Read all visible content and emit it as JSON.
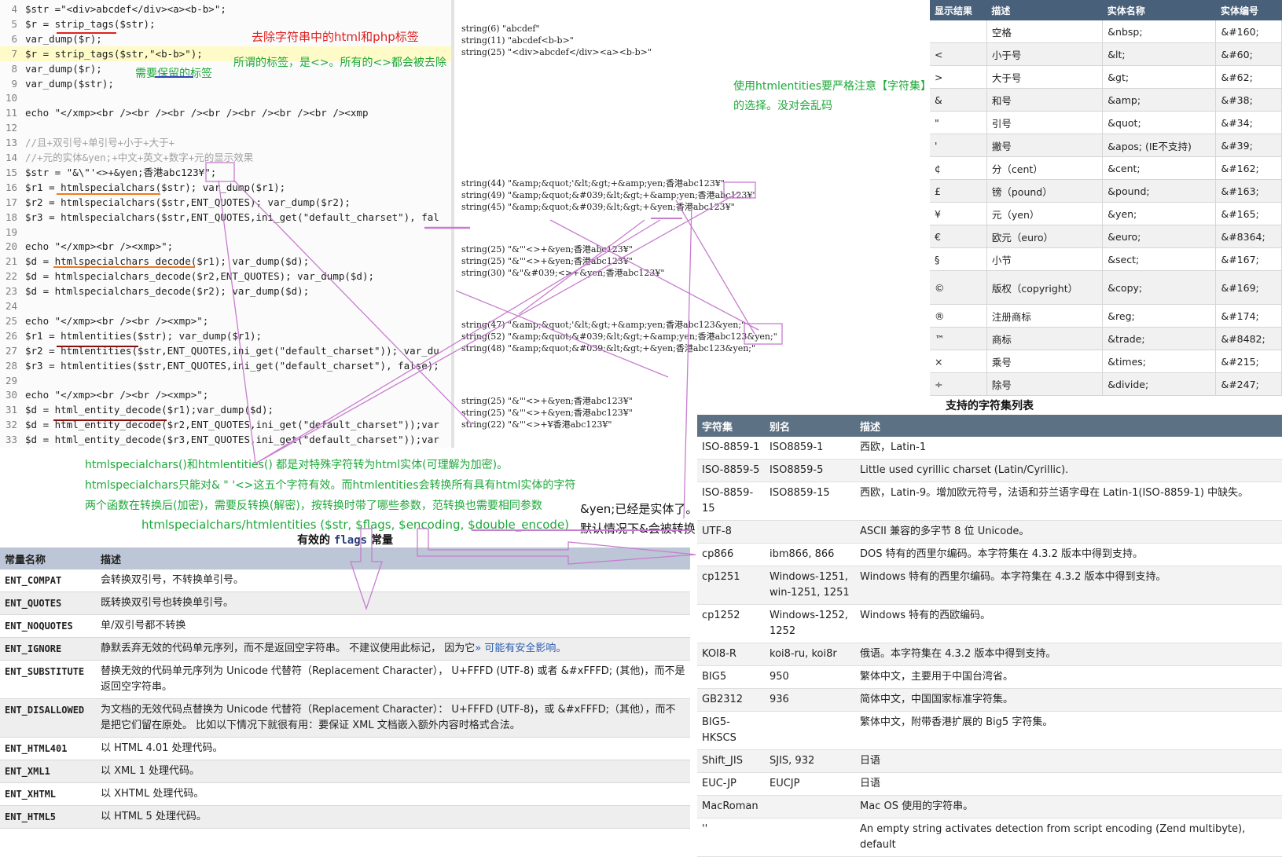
{
  "code_lines": [
    {
      "n": "4",
      "text": "$str =\"<div>abcdef</div><a><b-b>\";"
    },
    {
      "n": "5",
      "text": "$r = strip_tags($str);"
    },
    {
      "n": "6",
      "text": "var_dump($r);"
    },
    {
      "n": "7",
      "text": "$r = strip_tags($str,\"<b-b>\");"
    },
    {
      "n": "8",
      "text": "var_dump($r);"
    },
    {
      "n": "9",
      "text": "var_dump($str);"
    },
    {
      "n": "10",
      "text": ""
    },
    {
      "n": "11",
      "text": "echo \"</xmp><br /><br /><br /><br /><br /><br /><br /><xmp"
    },
    {
      "n": "12",
      "text": ""
    },
    {
      "n": "13",
      "text": "//且+双引号+单引号+小于+大于+"
    },
    {
      "n": "14",
      "text": "//+元的实体&yen;+中文+英文+数字+元的显示效果"
    },
    {
      "n": "15",
      "text": "$str = \"&\\\"'<>+&yen;香港abc123¥\";"
    },
    {
      "n": "16",
      "text": "$r1 = htmlspecialchars($str); var_dump($r1);"
    },
    {
      "n": "17",
      "text": "$r2 = htmlspecialchars($str,ENT_QUOTES); var_dump($r2);"
    },
    {
      "n": "18",
      "text": "$r3 = htmlspecialchars($str,ENT_QUOTES,ini_get(\"default_charset\"), fal"
    },
    {
      "n": "19",
      "text": ""
    },
    {
      "n": "20",
      "text": "echo \"</xmp><br /><xmp>\";"
    },
    {
      "n": "21",
      "text": "$d = htmlspecialchars_decode($r1); var_dump($d);"
    },
    {
      "n": "22",
      "text": "$d = htmlspecialchars_decode($r2,ENT_QUOTES); var_dump($d);"
    },
    {
      "n": "23",
      "text": "$d = htmlspecialchars_decode($r2); var_dump($d);"
    },
    {
      "n": "24",
      "text": ""
    },
    {
      "n": "25",
      "text": "echo \"</xmp><br /><br /><xmp>\";"
    },
    {
      "n": "26",
      "text": "$r1 = htmlentities($str); var_dump($r1);"
    },
    {
      "n": "27",
      "text": "$r2 = htmlentities($str,ENT_QUOTES,ini_get(\"default_charset\")); var_du"
    },
    {
      "n": "28",
      "text": "$r3 = htmlentities($str,ENT_QUOTES,ini_get(\"default_charset\"), false);"
    },
    {
      "n": "29",
      "text": ""
    },
    {
      "n": "30",
      "text": "echo \"</xmp><br /><br /><xmp>\";"
    },
    {
      "n": "31",
      "text": "$d = html_entity_decode($r1);var_dump($d);"
    },
    {
      "n": "32",
      "text": "$d = html_entity_decode($r2,ENT_QUOTES,ini_get(\"default_charset\"));var"
    },
    {
      "n": "33",
      "text": "$d = html_entity_decode($r3,ENT_QUOTES,ini_get(\"default_charset\"));var"
    }
  ],
  "output_blocks": [
    {
      "lines": [
        "string(6) \"abcdef\"",
        "string(11) \"abcdef<b-b>\"",
        "string(25) \"<div>abcdef</div><a><b-b>\""
      ]
    },
    {
      "lines": [
        "string(44) \"&amp;&quot;'&lt;&gt;+&amp;yen;香港abc123¥\"",
        "string(49) \"&amp;&quot;&#039;&lt;&gt;+&amp;yen;香港abc123¥\"",
        "string(45) \"&amp;&quot;&#039;&lt;&gt;+&yen;香港abc123¥\""
      ]
    },
    {
      "lines": [
        "string(25) \"&\"'<>+&yen;香港abc123¥\"",
        "string(25) \"&\"'<>+&yen;香港abc123¥\"",
        "string(30) \"&\"&#039;<>+&yen;香港abc123¥\""
      ]
    },
    {
      "lines": [
        "string(47) \"&amp;&quot;'&lt;&gt;+&amp;yen;香港abc123&yen;\"",
        "string(52) \"&amp;&quot;&#039;&lt;&gt;+&amp;yen;香港abc123&yen;\"",
        "string(48) \"&amp;&quot;&#039;&lt;&gt;+&yen;香港abc123&yen;\""
      ]
    },
    {
      "lines": [
        "string(25) \"&\"'<>+&yen;香港abc123¥\"",
        "string(25) \"&\"'<>+&yen;香港abc123¥\"",
        "string(22) \"&\"'<>+¥香港abc123¥\""
      ]
    }
  ],
  "annotations": {
    "strip_tags_note": "去除字符串中的html和php标签",
    "tags_note": "所谓的标签，是<>。所有的<>都会被去除",
    "keep_note": "需要保留的标签",
    "charset_note_1": "使用htmlentities要严格注意【字符集】",
    "charset_note_2": "的选择。没对会乱码",
    "convert_note": "htmlspecialchars()和htmlentities() 都是对特殊字符转为html实体(可理解为加密)。",
    "five_chars_note": "htmlspecialchars只能对& \" '<>这五个字符有效。而htmlentities会转换所有具有html实体的字符",
    "decode_note": "两个函数在转换后(加密)，需要反转换(解密)，按转换时带了哪些参数，范转换也需要相同参数",
    "signature": "htmlspecialchars/htmlentities ($str,  $flags, $encoding, $double_encode)",
    "yen_note": "&yen;已经是实体了。",
    "default_note": "默认情况下&会被转换"
  },
  "entity_table": {
    "headers": [
      "显示结果",
      "描述",
      "实体名称",
      "实体编号"
    ],
    "rows": [
      [
        "",
        "空格",
        "&nbsp;",
        "&#160;"
      ],
      [
        "<",
        "小于号",
        "&lt;",
        "&#60;"
      ],
      [
        ">",
        "大于号",
        "&gt;",
        "&#62;"
      ],
      [
        "&",
        "和号",
        "&amp;",
        "&#38;"
      ],
      [
        "\"",
        "引号",
        "&quot;",
        "&#34;"
      ],
      [
        "'",
        "撇号",
        "&apos; (IE不支持)",
        "&#39;"
      ],
      [
        "¢",
        "分（cent）",
        "&cent;",
        "&#162;"
      ],
      [
        "£",
        "镑（pound）",
        "&pound;",
        "&#163;"
      ],
      [
        "¥",
        "元（yen）",
        "&yen;",
        "&#165;"
      ],
      [
        "€",
        "欧元（euro）",
        "&euro;",
        "&#8364;"
      ],
      [
        "§",
        "小节",
        "&sect;",
        "&#167;"
      ],
      [
        "©",
        "版权（copyright）",
        "&copy;",
        "&#169;"
      ],
      [
        "®",
        "注册商标",
        "&reg;",
        "&#174;"
      ],
      [
        "™",
        "商标",
        "&trade;",
        "&#8482;"
      ],
      [
        "×",
        "乘号",
        "&times;",
        "&#215;"
      ],
      [
        "÷",
        "除号",
        "&divide;",
        "&#247;"
      ]
    ]
  },
  "charset_table": {
    "caption": "支持的字符集列表",
    "headers": [
      "字符集",
      "别名",
      "描述"
    ],
    "rows": [
      [
        "ISO-8859-1",
        "ISO8859-1",
        "西欧，Latin-1"
      ],
      [
        "ISO-8859-5",
        "ISO8859-5",
        "Little used cyrillic charset (Latin/Cyrillic)."
      ],
      [
        "ISO-8859-15",
        "ISO8859-15",
        "西欧，Latin-9。增加欧元符号，法语和芬兰语字母在 Latin-1(ISO-8859-1) 中缺失。"
      ],
      [
        "UTF-8",
        "",
        "ASCII 兼容的多字节 8 位 Unicode。"
      ],
      [
        "cp866",
        "ibm866, 866",
        "DOS 特有的西里尔编码。本字符集在 4.3.2 版本中得到支持。"
      ],
      [
        "cp1251",
        "Windows-1251, win-1251, 1251",
        "Windows 特有的西里尔编码。本字符集在 4.3.2 版本中得到支持。"
      ],
      [
        "cp1252",
        "Windows-1252, 1252",
        "Windows 特有的西欧编码。"
      ],
      [
        "KOI8-R",
        "koi8-ru, koi8r",
        "俄语。本字符集在 4.3.2 版本中得到支持。"
      ],
      [
        "BIG5",
        "950",
        "繁体中文，主要用于中国台湾省。"
      ],
      [
        "GB2312",
        "936",
        "简体中文，中国国家标准字符集。"
      ],
      [
        "BIG5-HKSCS",
        "",
        "繁体中文，附带香港扩展的 Big5 字符集。"
      ],
      [
        "Shift_JIS",
        "SJIS, 932",
        "日语"
      ],
      [
        "EUC-JP",
        "EUCJP",
        "日语"
      ],
      [
        "MacRoman",
        "",
        "Mac OS 使用的字符串。"
      ],
      [
        "''",
        "",
        "An empty string activates detection from script encoding (Zend multibyte), default"
      ]
    ]
  },
  "flags_table": {
    "caption_prefix": "有效的 ",
    "caption_code": "flags",
    "caption_suffix": " 常量",
    "headers": [
      "常量名称",
      "描述"
    ],
    "rows": [
      {
        "k": "ENT_COMPAT",
        "d": "会转换双引号，不转换单引号。",
        "link": ""
      },
      {
        "k": "ENT_QUOTES",
        "d": "既转换双引号也转换单引号。",
        "link": ""
      },
      {
        "k": "ENT_NOQUOTES",
        "d": "单/双引号都不转换",
        "link": ""
      },
      {
        "k": "ENT_IGNORE",
        "d": "静默丢弃无效的代码单元序列，而不是返回空字符串。 不建议使用此标记， 因为它",
        "link": "» 可能有安全影响。"
      },
      {
        "k": "ENT_SUBSTITUTE",
        "d": "替换无效的代码单元序列为 Unicode 代替符（Replacement Character）， U+FFFD (UTF-8) 或者 &#xFFFD; (其他)，而不是返回空字符串。",
        "link": ""
      },
      {
        "k": "ENT_DISALLOWED",
        "d": "为文档的无效代码点替换为 Unicode 代替符（Replacement Character）： U+FFFD (UTF-8)，或 &#xFFFD;（其他），而不是把它们留在原处。 比如以下情况下就很有用：要保证 XML 文档嵌入额外内容时格式合法。",
        "link": ""
      },
      {
        "k": "ENT_HTML401",
        "d": "以 HTML 4.01 处理代码。",
        "link": ""
      },
      {
        "k": "ENT_XML1",
        "d": "以 XML 1 处理代码。",
        "link": ""
      },
      {
        "k": "ENT_XHTML",
        "d": "以 XHTML 处理代码。",
        "link": ""
      },
      {
        "k": "ENT_HTML5",
        "d": "以 HTML 5 处理代码。",
        "link": ""
      }
    ]
  },
  "colors": {
    "red": "#e02020",
    "green": "#1ea83a",
    "violet": "#c77dcf",
    "header_dark": "#48607a"
  }
}
